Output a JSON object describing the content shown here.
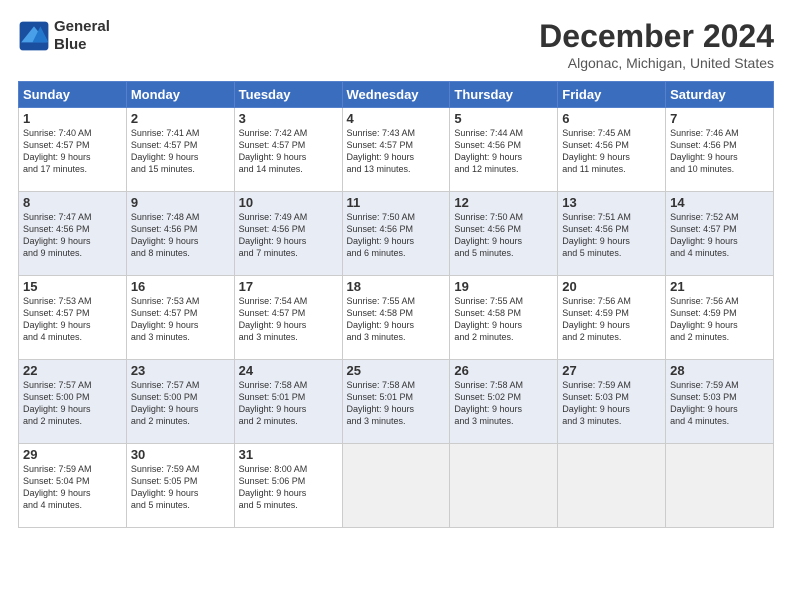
{
  "logo": {
    "line1": "General",
    "line2": "Blue"
  },
  "title": "December 2024",
  "location": "Algonac, Michigan, United States",
  "weekdays": [
    "Sunday",
    "Monday",
    "Tuesday",
    "Wednesday",
    "Thursday",
    "Friday",
    "Saturday"
  ],
  "weeks": [
    [
      {
        "day": "1",
        "info": "Sunrise: 7:40 AM\nSunset: 4:57 PM\nDaylight: 9 hours\nand 17 minutes."
      },
      {
        "day": "2",
        "info": "Sunrise: 7:41 AM\nSunset: 4:57 PM\nDaylight: 9 hours\nand 15 minutes."
      },
      {
        "day": "3",
        "info": "Sunrise: 7:42 AM\nSunset: 4:57 PM\nDaylight: 9 hours\nand 14 minutes."
      },
      {
        "day": "4",
        "info": "Sunrise: 7:43 AM\nSunset: 4:57 PM\nDaylight: 9 hours\nand 13 minutes."
      },
      {
        "day": "5",
        "info": "Sunrise: 7:44 AM\nSunset: 4:56 PM\nDaylight: 9 hours\nand 12 minutes."
      },
      {
        "day": "6",
        "info": "Sunrise: 7:45 AM\nSunset: 4:56 PM\nDaylight: 9 hours\nand 11 minutes."
      },
      {
        "day": "7",
        "info": "Sunrise: 7:46 AM\nSunset: 4:56 PM\nDaylight: 9 hours\nand 10 minutes."
      }
    ],
    [
      {
        "day": "8",
        "info": "Sunrise: 7:47 AM\nSunset: 4:56 PM\nDaylight: 9 hours\nand 9 minutes."
      },
      {
        "day": "9",
        "info": "Sunrise: 7:48 AM\nSunset: 4:56 PM\nDaylight: 9 hours\nand 8 minutes."
      },
      {
        "day": "10",
        "info": "Sunrise: 7:49 AM\nSunset: 4:56 PM\nDaylight: 9 hours\nand 7 minutes."
      },
      {
        "day": "11",
        "info": "Sunrise: 7:50 AM\nSunset: 4:56 PM\nDaylight: 9 hours\nand 6 minutes."
      },
      {
        "day": "12",
        "info": "Sunrise: 7:50 AM\nSunset: 4:56 PM\nDaylight: 9 hours\nand 5 minutes."
      },
      {
        "day": "13",
        "info": "Sunrise: 7:51 AM\nSunset: 4:56 PM\nDaylight: 9 hours\nand 5 minutes."
      },
      {
        "day": "14",
        "info": "Sunrise: 7:52 AM\nSunset: 4:57 PM\nDaylight: 9 hours\nand 4 minutes."
      }
    ],
    [
      {
        "day": "15",
        "info": "Sunrise: 7:53 AM\nSunset: 4:57 PM\nDaylight: 9 hours\nand 4 minutes."
      },
      {
        "day": "16",
        "info": "Sunrise: 7:53 AM\nSunset: 4:57 PM\nDaylight: 9 hours\nand 3 minutes."
      },
      {
        "day": "17",
        "info": "Sunrise: 7:54 AM\nSunset: 4:57 PM\nDaylight: 9 hours\nand 3 minutes."
      },
      {
        "day": "18",
        "info": "Sunrise: 7:55 AM\nSunset: 4:58 PM\nDaylight: 9 hours\nand 3 minutes."
      },
      {
        "day": "19",
        "info": "Sunrise: 7:55 AM\nSunset: 4:58 PM\nDaylight: 9 hours\nand 2 minutes."
      },
      {
        "day": "20",
        "info": "Sunrise: 7:56 AM\nSunset: 4:59 PM\nDaylight: 9 hours\nand 2 minutes."
      },
      {
        "day": "21",
        "info": "Sunrise: 7:56 AM\nSunset: 4:59 PM\nDaylight: 9 hours\nand 2 minutes."
      }
    ],
    [
      {
        "day": "22",
        "info": "Sunrise: 7:57 AM\nSunset: 5:00 PM\nDaylight: 9 hours\nand 2 minutes."
      },
      {
        "day": "23",
        "info": "Sunrise: 7:57 AM\nSunset: 5:00 PM\nDaylight: 9 hours\nand 2 minutes."
      },
      {
        "day": "24",
        "info": "Sunrise: 7:58 AM\nSunset: 5:01 PM\nDaylight: 9 hours\nand 2 minutes."
      },
      {
        "day": "25",
        "info": "Sunrise: 7:58 AM\nSunset: 5:01 PM\nDaylight: 9 hours\nand 3 minutes."
      },
      {
        "day": "26",
        "info": "Sunrise: 7:58 AM\nSunset: 5:02 PM\nDaylight: 9 hours\nand 3 minutes."
      },
      {
        "day": "27",
        "info": "Sunrise: 7:59 AM\nSunset: 5:03 PM\nDaylight: 9 hours\nand 3 minutes."
      },
      {
        "day": "28",
        "info": "Sunrise: 7:59 AM\nSunset: 5:03 PM\nDaylight: 9 hours\nand 4 minutes."
      }
    ],
    [
      {
        "day": "29",
        "info": "Sunrise: 7:59 AM\nSunset: 5:04 PM\nDaylight: 9 hours\nand 4 minutes."
      },
      {
        "day": "30",
        "info": "Sunrise: 7:59 AM\nSunset: 5:05 PM\nDaylight: 9 hours\nand 5 minutes."
      },
      {
        "day": "31",
        "info": "Sunrise: 8:00 AM\nSunset: 5:06 PM\nDaylight: 9 hours\nand 5 minutes."
      },
      {
        "day": "",
        "info": ""
      },
      {
        "day": "",
        "info": ""
      },
      {
        "day": "",
        "info": ""
      },
      {
        "day": "",
        "info": ""
      }
    ]
  ]
}
